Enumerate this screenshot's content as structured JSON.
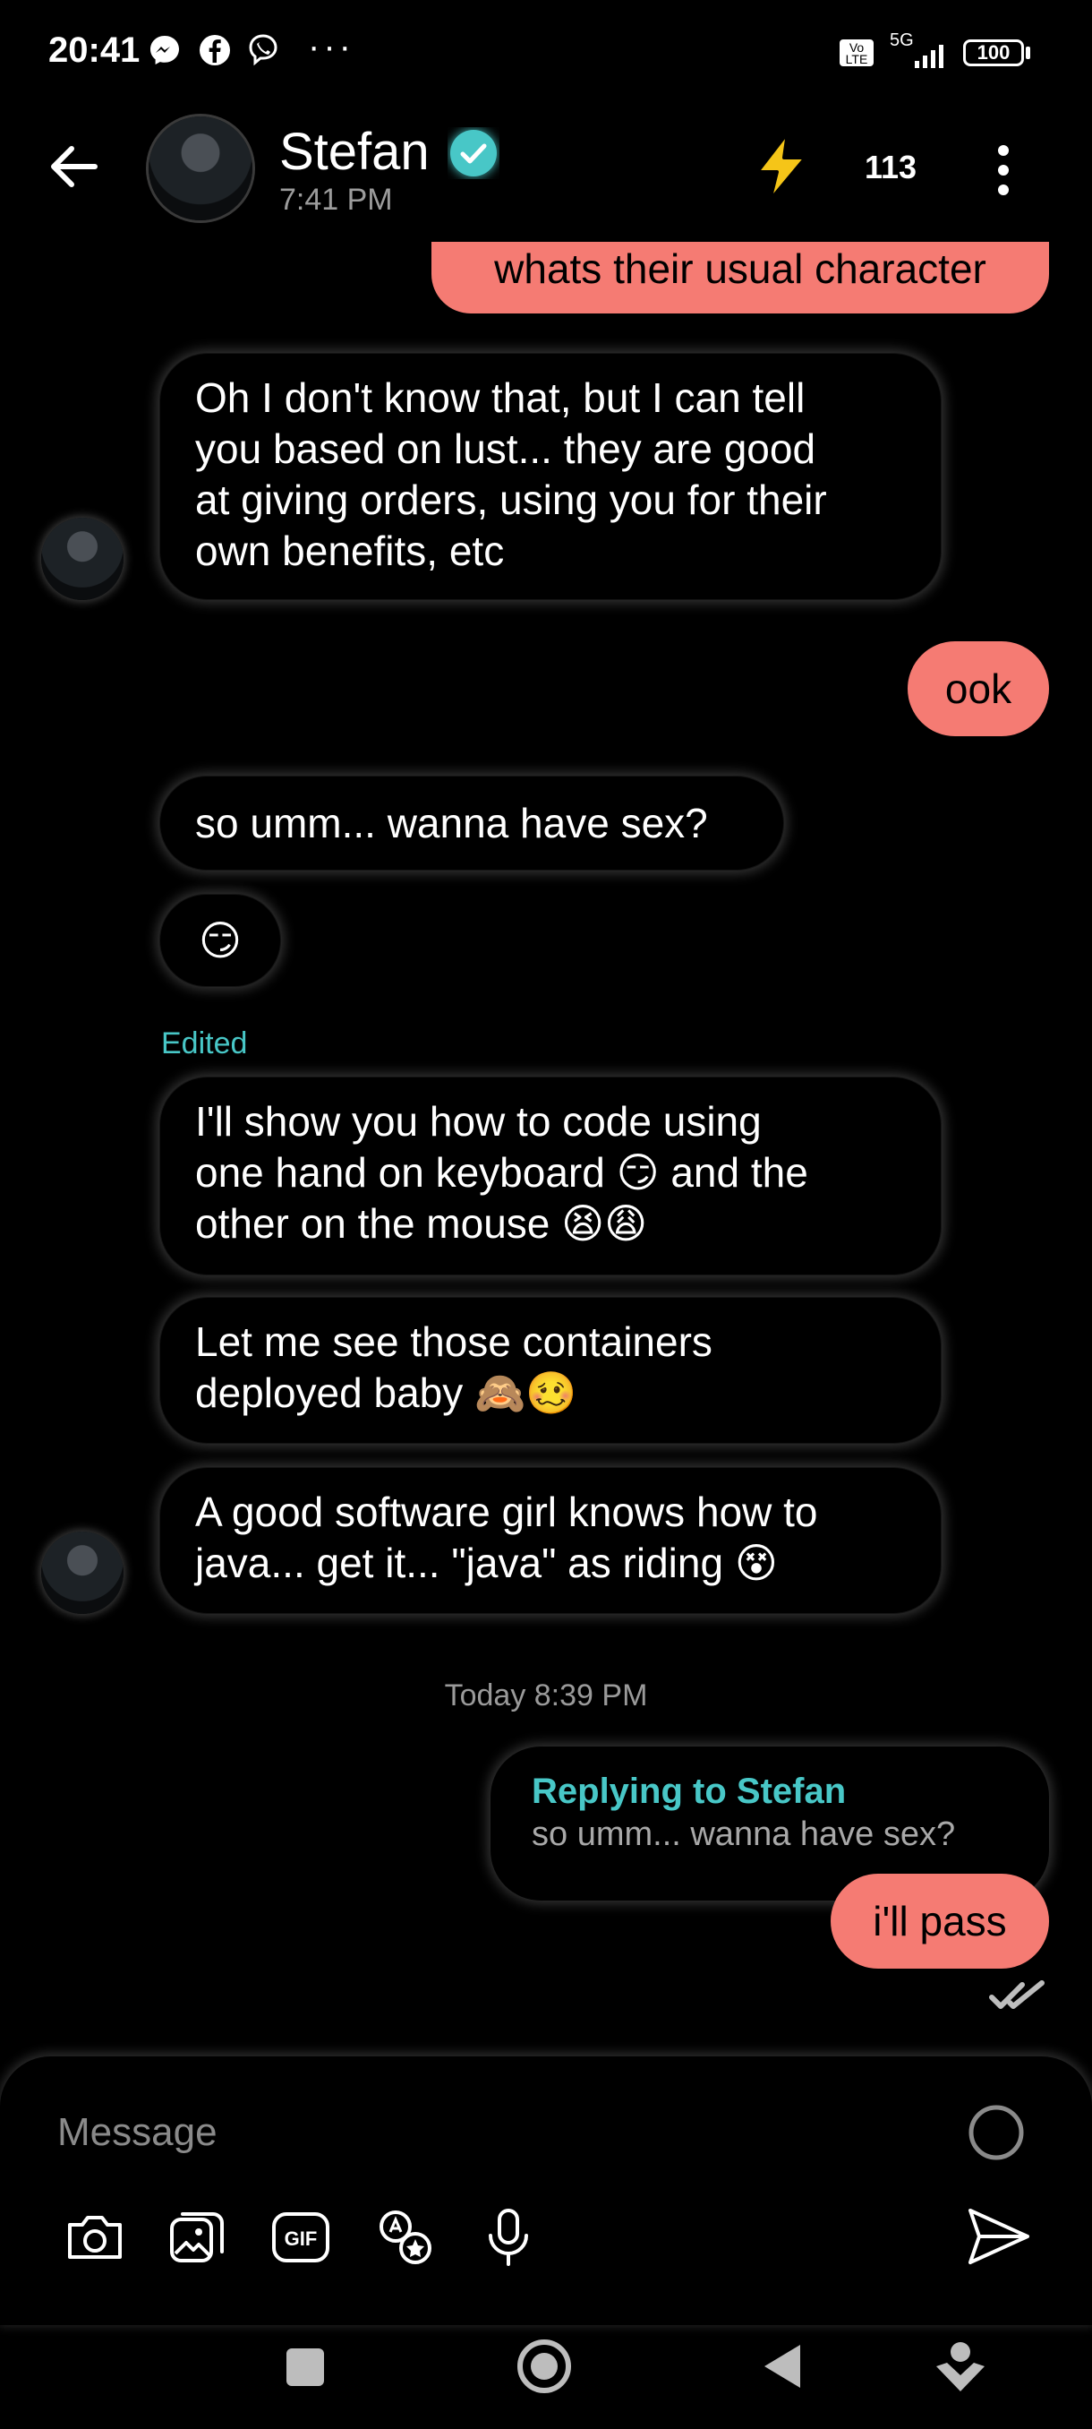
{
  "status_bar": {
    "time": "20:41",
    "network": "5G",
    "volte": "Vo LTE",
    "battery": "100",
    "icons": [
      "messenger-icon",
      "facebook-icon",
      "viber-icon",
      "more-dots-icon",
      "signal-icon",
      "battery-icon"
    ]
  },
  "header": {
    "name": "Stefan",
    "subtitle": "7:41 PM",
    "count": "113",
    "icons": [
      "back-arrow-icon",
      "verified-badge-icon",
      "lightning-icon",
      "more-vert-icon"
    ]
  },
  "messages": [
    {
      "side": "out",
      "text": "whats their usual character"
    },
    {
      "side": "in",
      "lines": [
        "Oh I don't know that, but I can tell",
        "you based on lust... they are good",
        "at giving orders, using you for their",
        "own benefits, etc"
      ]
    },
    {
      "side": "out",
      "text": "ook"
    },
    {
      "side": "in",
      "text": "so umm... wanna have sex?"
    },
    {
      "side": "in",
      "text": "😏"
    },
    {
      "side": "in",
      "edited_label": "Edited",
      "lines": [
        "I'll show you how to code using",
        "one hand on keyboard 😏 and the",
        "other on the mouse 😫😩"
      ]
    },
    {
      "side": "in",
      "lines": [
        "Let me see those containers",
        "deployed baby 🙈🥴"
      ]
    },
    {
      "side": "in",
      "lines": [
        "A good software girl knows how to",
        "java... get it... \"java\" as riding 😵"
      ]
    }
  ],
  "timestamp": "Today 8:39 PM",
  "reply": {
    "title": "Replying to Stefan",
    "quoted": "so umm... wanna have sex?",
    "text": "i'll pass",
    "status_icon": "double-check-icon"
  },
  "composer": {
    "placeholder": "Message",
    "tools": [
      "camera-icon",
      "gallery-icon",
      "gif-icon",
      "sticker-icon",
      "microphone-icon"
    ],
    "gif_label": "GIF",
    "send_icon": "send-icon"
  },
  "nav_bar": [
    "recents-icon",
    "home-icon",
    "back-icon",
    "assistant-icon"
  ],
  "colors": {
    "accent": "#48c7c7",
    "outgoing": "#f57b73",
    "background": "#000000"
  }
}
